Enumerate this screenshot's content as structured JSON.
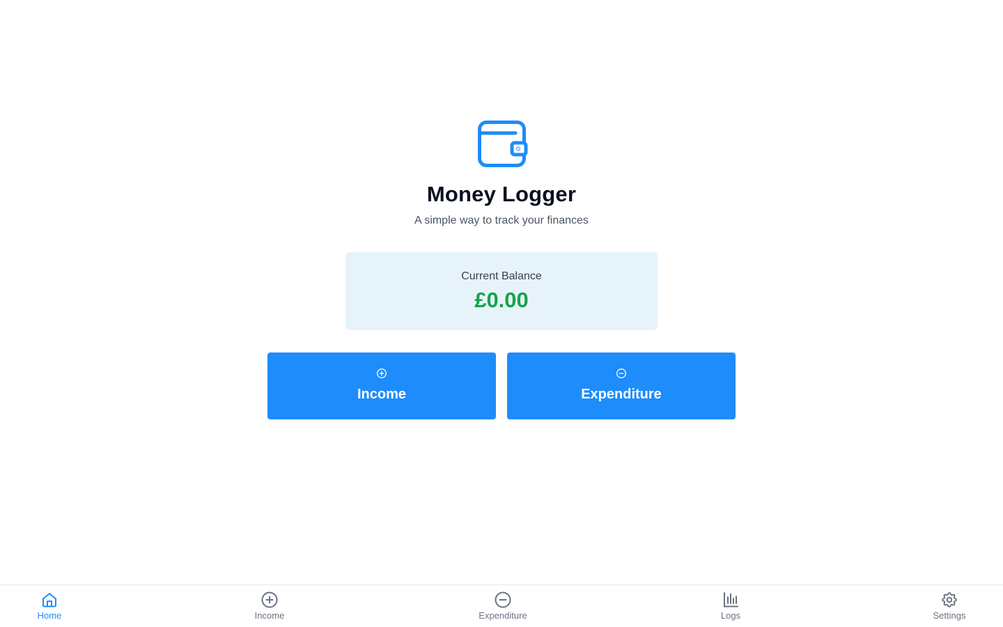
{
  "colors": {
    "accent": "#1e8cfa",
    "balance_positive": "#16a34a",
    "balance_card_bg": "#e7f3fb",
    "nav_inactive": "#6b7280"
  },
  "header": {
    "logo_icon": "wallet-icon",
    "title": "Money Logger",
    "subtitle": "A simple way to track your finances"
  },
  "balance": {
    "label": "Current Balance",
    "value": "£0.00"
  },
  "actions": {
    "income": {
      "label": "Income",
      "icon": "plus-circle-icon"
    },
    "expenditure": {
      "label": "Expenditure",
      "icon": "minus-circle-icon"
    }
  },
  "nav": {
    "active": "home",
    "items": [
      {
        "id": "home",
        "label": "Home",
        "icon": "home-icon"
      },
      {
        "id": "income",
        "label": "Income",
        "icon": "plus-circle-icon"
      },
      {
        "id": "expenditure",
        "label": "Expenditure",
        "icon": "minus-circle-icon"
      },
      {
        "id": "logs",
        "label": "Logs",
        "icon": "bar-chart-icon"
      },
      {
        "id": "settings",
        "label": "Settings",
        "icon": "gear-icon"
      }
    ]
  }
}
